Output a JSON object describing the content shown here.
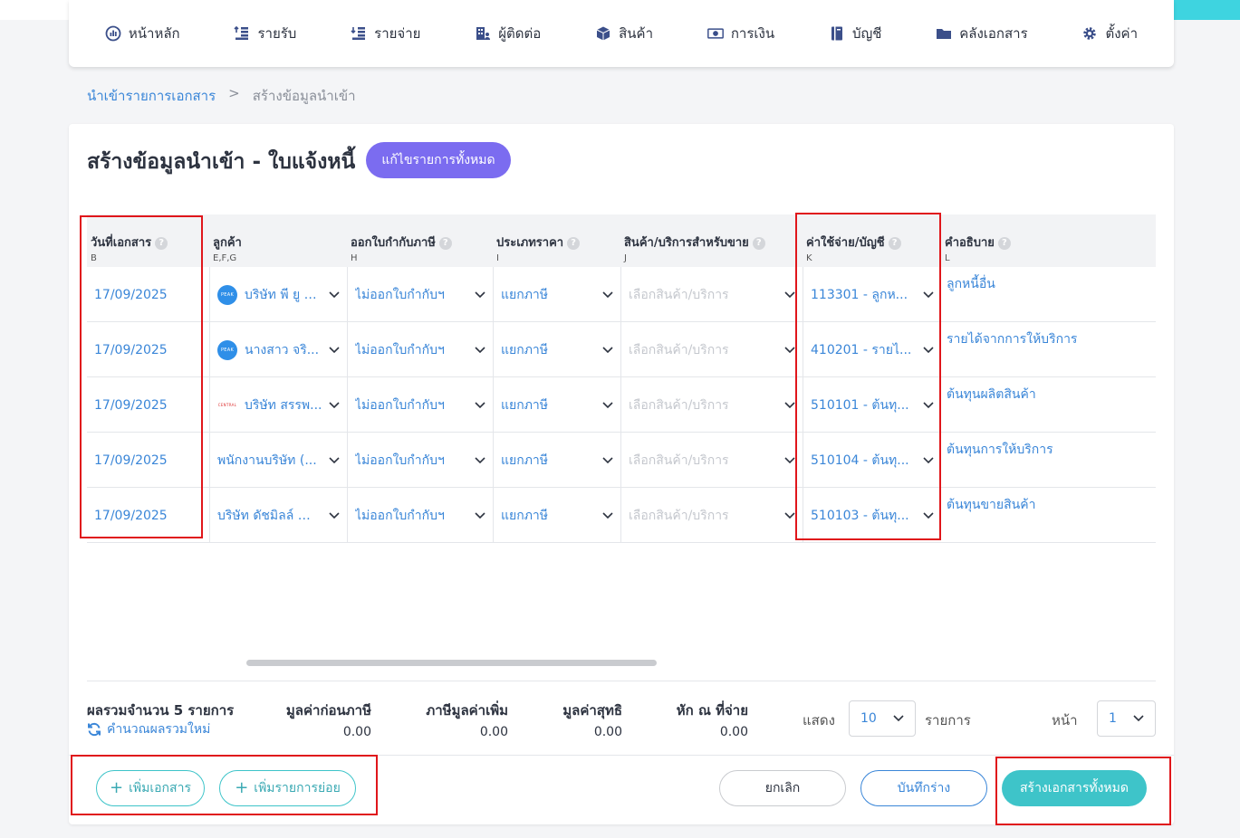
{
  "nav": {
    "items": [
      {
        "label": "หน้าหลัก",
        "icon": "dashboard-icon"
      },
      {
        "label": "รายรับ",
        "icon": "income-icon"
      },
      {
        "label": "รายจ่าย",
        "icon": "expense-icon"
      },
      {
        "label": "ผู้ติดต่อ",
        "icon": "contacts-icon"
      },
      {
        "label": "สินค้า",
        "icon": "product-box-icon"
      },
      {
        "label": "การเงิน",
        "icon": "money-icon"
      },
      {
        "label": "บัญชี",
        "icon": "ledger-icon"
      },
      {
        "label": "คลังเอกสาร",
        "icon": "folder-icon"
      },
      {
        "label": "ตั้งค่า",
        "icon": "gear-icon"
      }
    ]
  },
  "breadcrumb": {
    "parent": "นำเข้ารายการเอกสาร",
    "separator": ">",
    "current": "สร้างข้อมูลนำเข้า"
  },
  "page": {
    "title": "สร้างข้อมูลนำเข้า - ใบแจ้งหนี้",
    "edit_all_label": "แก้ไขรายการทั้งหมด"
  },
  "table": {
    "headers": [
      {
        "label": "วันที่เอกสาร",
        "code": "B",
        "help": true
      },
      {
        "label": "ลูกค้า",
        "code": "E,F,G",
        "help": false
      },
      {
        "label": "ออกใบกำกับภาษี",
        "code": "H",
        "help": true
      },
      {
        "label": "ประเภทราคา",
        "code": "I",
        "help": true
      },
      {
        "label": "สินค้า/บริการสำหรับขาย",
        "code": "J",
        "help": true
      },
      {
        "label": "ค่าใช้จ่าย/บัญชี",
        "code": "K",
        "help": true
      },
      {
        "label": "คำอธิบาย",
        "code": "L",
        "help": true
      }
    ],
    "rows": [
      {
        "date": "17/09/2025",
        "customer": "บริษัท พี ยู ยู...",
        "customer_logo": "PEAK",
        "tax_invoice": "ไม่ออกใบกำกับฯ",
        "price_type": "แยกภาษี",
        "product": "เลือกสินค้า/บริการ",
        "account": "113301 - ลูกห...",
        "description": "ลูกหนี้อื่น"
      },
      {
        "date": "17/09/2025",
        "customer": "นางสาว จริ...",
        "customer_logo": "PEAK",
        "tax_invoice": "ไม่ออกใบกำกับฯ",
        "price_type": "แยกภาษี",
        "product": "เลือกสินค้า/บริการ",
        "account": "410201 - รายไ...",
        "description": "รายได้จากการให้บริการ"
      },
      {
        "date": "17/09/2025",
        "customer": "บริษัท สรรพ...",
        "customer_logo": "CENTRAL",
        "tax_invoice": "ไม่ออกใบกำกับฯ",
        "price_type": "แยกภาษี",
        "product": "เลือกสินค้า/บริการ",
        "account": "510101 - ต้นทุ...",
        "description": "ต้นทุนผลิตสินค้า"
      },
      {
        "date": "17/09/2025",
        "customer": "พนักงานบริษัท (...",
        "customer_logo": "",
        "tax_invoice": "ไม่ออกใบกำกับฯ",
        "price_type": "แยกภาษี",
        "product": "เลือกสินค้า/บริการ",
        "account": "510104 - ต้นทุ...",
        "description": "ต้นทุนการให้บริการ"
      },
      {
        "date": "17/09/2025",
        "customer": "บริษัท ดัชมิลล์ จำ...",
        "customer_logo": "",
        "tax_invoice": "ไม่ออกใบกำกับฯ",
        "price_type": "แยกภาษี",
        "product": "เลือกสินค้า/บริการ",
        "account": "510103 - ต้นทุ...",
        "description": "ต้นทุนขายสินค้า"
      }
    ]
  },
  "summary": {
    "total_label": "ผลรวมจำนวน 5 รายการ",
    "recalc_label": "คำนวณผลรวมใหม่",
    "pre_tax_label": "มูลค่าก่อนภาษี",
    "pre_tax_value": "0.00",
    "vat_label": "ภาษีมูลค่าเพิ่ม",
    "vat_value": "0.00",
    "net_label": "มูลค่าสุทธิ",
    "net_value": "0.00",
    "wht_label": "หัก ณ ที่จ่าย",
    "wht_value": "0.00"
  },
  "pager": {
    "show_label": "แสดง",
    "per_page": "10",
    "items_label": "รายการ",
    "page_label": "หน้า",
    "page": "1"
  },
  "footer": {
    "add_document": "เพิ่มเอกสาร",
    "add_item": "เพิ่มรายการย่อย",
    "cancel": "ยกเลิก",
    "save_draft": "บันทึกร่าง",
    "create_all": "สร้างเอกสารทั้งหมด"
  },
  "colors": {
    "accent_teal": "#3ec4c9",
    "accent_purple": "#7b6cf0",
    "link_blue": "#3a86d8",
    "highlight_red": "#e0161b"
  }
}
